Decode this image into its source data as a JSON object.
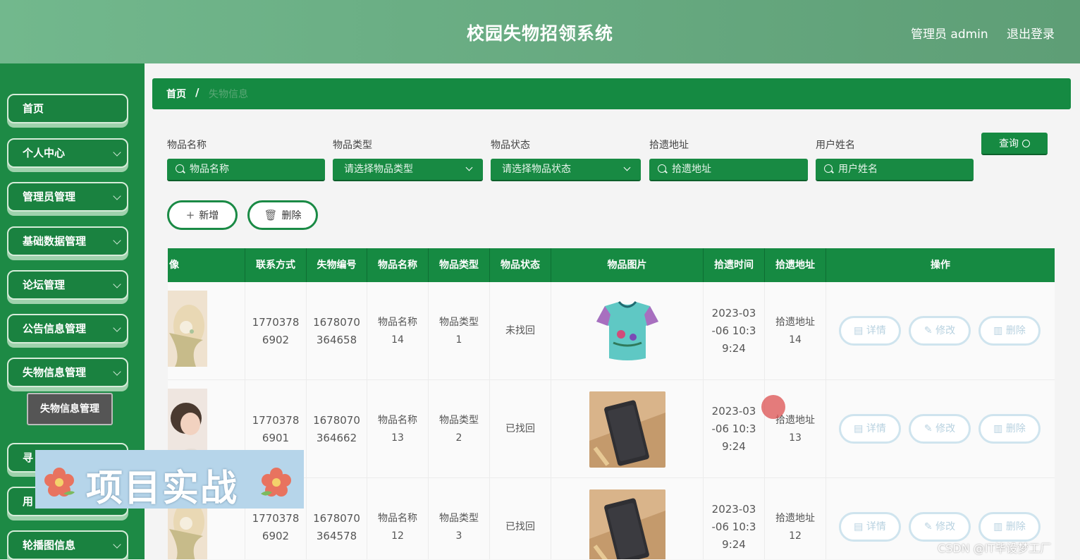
{
  "header": {
    "title": "校园失物招领系统",
    "user": "管理员 admin",
    "logout": "退出登录"
  },
  "sidebar": {
    "items": [
      {
        "label": "首页",
        "has_children": false
      },
      {
        "label": "个人中心",
        "has_children": true
      },
      {
        "label": "管理员管理",
        "has_children": true
      },
      {
        "label": "基础数据管理",
        "has_children": true
      },
      {
        "label": "论坛管理",
        "has_children": true
      },
      {
        "label": "公告信息管理",
        "has_children": true
      },
      {
        "label": "失物信息管理",
        "has_children": true
      },
      {
        "label": "寻",
        "has_children": true
      },
      {
        "label": "用",
        "has_children": true
      },
      {
        "label": "轮播图信息",
        "has_children": true
      }
    ],
    "active_sub": "失物信息管理"
  },
  "breadcrumb": {
    "home": "首页",
    "sep": "/",
    "current": "失物信息"
  },
  "filters": [
    {
      "label": "物品名称",
      "placeholder": "物品名称",
      "type": "text"
    },
    {
      "label": "物品类型",
      "placeholder": "请选择物品类型",
      "type": "select"
    },
    {
      "label": "物品状态",
      "placeholder": "请选择物品状态",
      "type": "select"
    },
    {
      "label": "拾遗地址",
      "placeholder": "拾遗地址",
      "type": "text"
    },
    {
      "label": "用户姓名",
      "placeholder": "用户姓名",
      "type": "text"
    }
  ],
  "actions": {
    "query": "查询",
    "add": "新增",
    "delete": "删除"
  },
  "table": {
    "columns": [
      "像",
      "联系方式",
      "失物编号",
      "物品名称",
      "物品类型",
      "物品状态",
      "物品图片",
      "拾遗时间",
      "拾遗地址",
      "操作"
    ],
    "rows": [
      {
        "phone": [
          "1770378",
          "6902"
        ],
        "code": [
          "1678070",
          "364658"
        ],
        "name": [
          "物品名称",
          "14"
        ],
        "type": [
          "物品类型",
          "1"
        ],
        "status": "未找回",
        "image": "shirt",
        "time": [
          "2023-03",
          "-06 10:3",
          "9:24"
        ],
        "addr": [
          "拾遗地址",
          "14"
        ]
      },
      {
        "phone": [
          "1770378",
          "6901"
        ],
        "code": [
          "1678070",
          "364662"
        ],
        "name": [
          "物品名称",
          "13"
        ],
        "type": [
          "物品类型",
          "2"
        ],
        "status": "已找回",
        "image": "wallet",
        "time": [
          "2023-03",
          "-06 10:3",
          "9:24"
        ],
        "addr": [
          "拾遗地址",
          "13"
        ]
      },
      {
        "phone": [
          "1770378",
          "6902"
        ],
        "code": [
          "1678070",
          "364578"
        ],
        "name": [
          "物品名称",
          "12"
        ],
        "type": [
          "物品类型",
          "3"
        ],
        "status": "已找回",
        "image": "wallet",
        "time": [
          "2023-03",
          "-06 10:3",
          "9:24"
        ],
        "addr": [
          "拾遗地址",
          "12"
        ]
      }
    ],
    "row_actions": [
      "详情",
      "修改",
      "删除"
    ]
  },
  "overlay": {
    "banner": "项目实战",
    "watermark": "CSDN @IT毕设梦工厂"
  },
  "colors": {
    "primary": "#168a42",
    "sidebar": "#1d8a45",
    "header": "#6aa982"
  }
}
